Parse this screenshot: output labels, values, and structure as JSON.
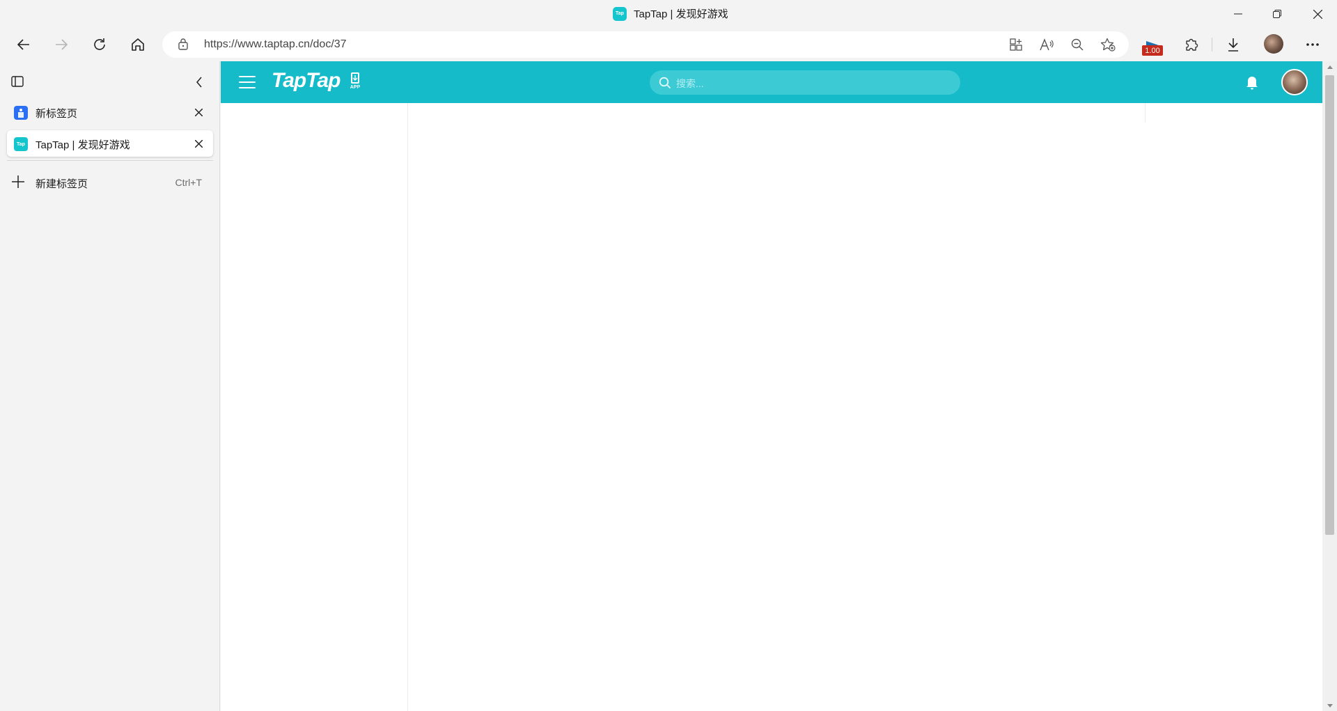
{
  "window": {
    "title": "TapTap | 发现好游戏",
    "favicon_text": "Tap"
  },
  "toolbar": {
    "url": "https://www.taptap.cn/doc/37",
    "extension_badge": "1.00"
  },
  "sidebar": {
    "tabs": [
      {
        "label": "新标签页",
        "active": false
      },
      {
        "label": "TapTap | 发现好游戏",
        "active": true,
        "favicon_text": "Tap"
      }
    ],
    "new_tab": {
      "label": "新建标签页",
      "shortcut": "Ctrl+T"
    }
  },
  "page": {
    "logo": "TapTap",
    "app_label": "APP",
    "search_placeholder": "搜索...",
    "colors": {
      "header": "#15bbc9",
      "search_bg": "#3ccbd5"
    }
  }
}
